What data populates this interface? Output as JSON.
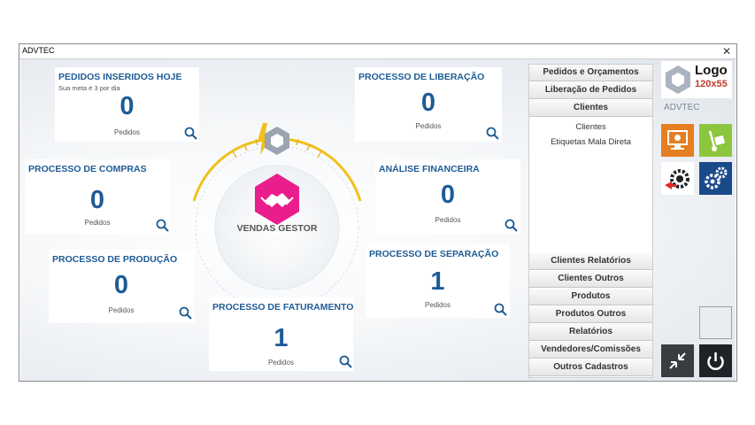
{
  "window": {
    "title": "ADVTEC",
    "close_symbol": "✕"
  },
  "panels": {
    "inseridos": {
      "title": "PEDIDOS INSERIDOS HOJE",
      "subtitle": "Sua meta é 3 por dia",
      "value": "0",
      "label": "Pedidos"
    },
    "liberacao": {
      "title": "PROCESSO DE LIBERAÇÃO",
      "value": "0",
      "label": "Pedidos"
    },
    "compras": {
      "title": "PROCESSO DE COMPRAS",
      "value": "0",
      "label": "Pedidos"
    },
    "financeira": {
      "title": "ANÁLISE FINANCEIRA",
      "value": "0",
      "label": "Pedidos"
    },
    "producao": {
      "title": "PROCESSO DE PRODUÇÃO",
      "value": "0",
      "label": "Pedidos"
    },
    "separacao": {
      "title": "PROCESSO DE SEPARAÇÃO",
      "value": "1",
      "label": "Pedidos"
    },
    "faturamento": {
      "title": "PROCESSO DE FATURAMENTO",
      "value": "1",
      "label": "Pedidos"
    }
  },
  "center": {
    "label": "VENDAS GESTOR"
  },
  "menu": {
    "top": [
      "Pedidos e Orçamentos",
      "Liberação de Pedidos",
      "Clientes"
    ],
    "submenu": [
      "Clientes",
      "Etiquetas Mala Direta"
    ],
    "bottom": [
      "Clientes Relatórios",
      "Clientes Outros",
      "Produtos",
      "Produtos Outros",
      "Relatórios",
      "Vendedores/Comissões",
      "Outros Cadastros"
    ]
  },
  "logo": {
    "line1": "Logo",
    "line2": "120x55"
  },
  "brand": "ADVTEC",
  "colors": {
    "accent": "#1e5b96",
    "orange": "#e67e22",
    "green": "#8cc63f",
    "navy": "#1a4a8a",
    "dark": "#1f2226",
    "magenta": "#e91e8c",
    "gold": "#f2c01c"
  },
  "icons": [
    "search-icon",
    "handshake-icon",
    "monitor-icon",
    "hand-truck-icon",
    "gear-arrow-icon",
    "gears-icon",
    "minimize-icon",
    "power-icon"
  ]
}
